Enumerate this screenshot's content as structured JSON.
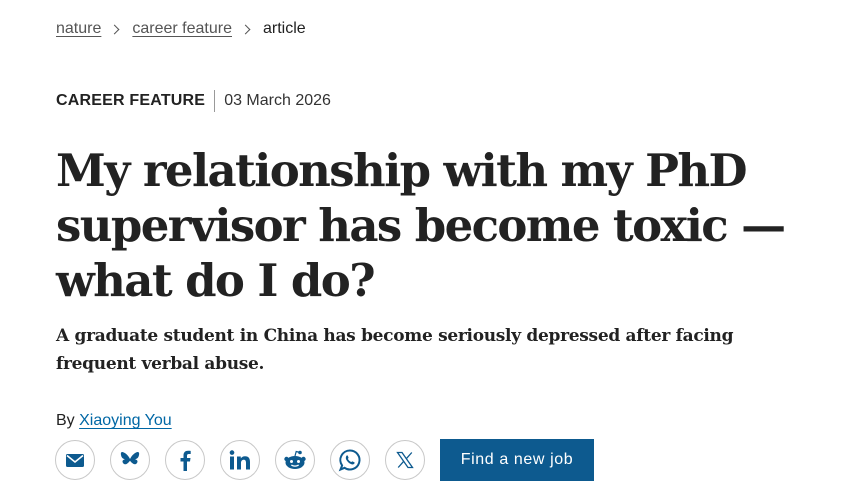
{
  "breadcrumb": {
    "items": [
      {
        "label": "nature"
      },
      {
        "label": "career feature"
      },
      {
        "label": "article"
      }
    ]
  },
  "meta": {
    "article_type": "CAREER FEATURE",
    "date": "03 March 2026"
  },
  "article": {
    "title": "My relationship with my PhD supervisor has become toxic — what do I do?",
    "standfirst": "A graduate student in China has become seriously depressed after facing frequent verbal abuse.",
    "byline_prefix": "By",
    "author": "Xiaoying You"
  },
  "share": {
    "buttons": [
      {
        "icon": "email-icon"
      },
      {
        "icon": "bluesky-icon"
      },
      {
        "icon": "facebook-icon"
      },
      {
        "icon": "linkedin-icon"
      },
      {
        "icon": "reddit-icon"
      },
      {
        "icon": "whatsapp-icon"
      },
      {
        "icon": "x-icon"
      }
    ],
    "job_button_label": "Find a new job"
  },
  "colors": {
    "link": "#0067a5",
    "share_icon": "#0d5a8f",
    "job_button_bg": "#0d5a8f",
    "text": "#222222"
  }
}
